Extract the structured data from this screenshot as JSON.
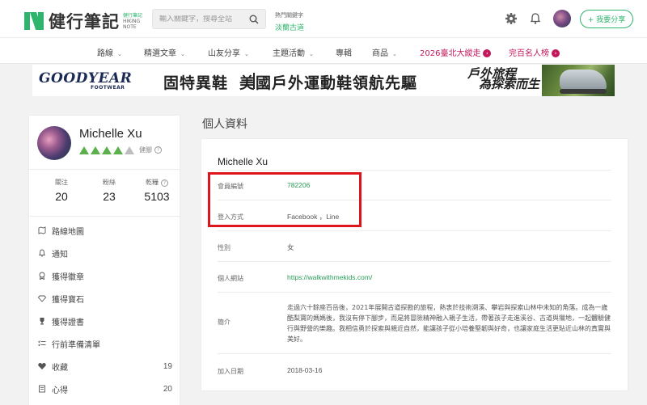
{
  "header": {
    "logo_text": "健行筆記",
    "logo_sub_cn": "健行筆記",
    "logo_sub_en1": "HIKING",
    "logo_sub_en2": "NOTE",
    "search_placeholder": "輸入關鍵字，搜尋全站",
    "hot_label": "熱門關鍵字",
    "hot_keyword": "淡蘭古道",
    "share_label": "+ 我要分享"
  },
  "nav": {
    "items": [
      {
        "label": "路線",
        "caret": "⌄"
      },
      {
        "label": "精選文章",
        "caret": "⌄"
      },
      {
        "label": "山友分享",
        "caret": "⌄"
      },
      {
        "label": "主題活動",
        "caret": "⌄"
      },
      {
        "label": "專輯"
      },
      {
        "label": "商品",
        "caret": "⌄"
      },
      {
        "label": "2026臺北大縱走",
        "badge": "›"
      },
      {
        "label": "完百名人榜",
        "badge": "›"
      }
    ]
  },
  "banner": {
    "brand": "GOODYEAR",
    "brand_sub": "FOOTWEAR",
    "slogan_left": "固特異鞋",
    "slogan_right": "美國戶外運動鞋領航先驅",
    "brush_line1": "戶外旅程",
    "brush_line2": "為探索而生"
  },
  "profile": {
    "name": "Michelle Xu",
    "level_label": "健腳",
    "level_filled": 4,
    "level_total": 5,
    "stats": [
      {
        "label": "關注",
        "value": "20"
      },
      {
        "label": "粉絲",
        "value": "23"
      },
      {
        "label": "乾糧",
        "value": "5103"
      }
    ],
    "menu": [
      {
        "label": "路線地圖",
        "icon": "map-icon",
        "count": ""
      },
      {
        "label": "通知",
        "icon": "bell-icon",
        "count": ""
      },
      {
        "label": "獲得徽章",
        "icon": "badge-icon",
        "count": ""
      },
      {
        "label": "獲得寶石",
        "icon": "gem-icon",
        "count": ""
      },
      {
        "label": "獲得證書",
        "icon": "trophy-icon",
        "count": ""
      },
      {
        "label": "行前準備清單",
        "icon": "checklist-icon",
        "count": ""
      },
      {
        "label": "收藏",
        "icon": "heart-icon",
        "count": "19"
      },
      {
        "label": "心得",
        "icon": "notes-icon",
        "count": "20"
      }
    ]
  },
  "main": {
    "section_title": "個人資料",
    "name": "Michelle Xu",
    "rows": [
      {
        "key": "會員編號",
        "value": "782206"
      },
      {
        "key": "登入方式",
        "value": "Facebook  ，Line"
      },
      {
        "key": "性別",
        "value": "女"
      },
      {
        "key": "個人網站",
        "value": "https://walkwithmekids.com/"
      },
      {
        "key": "簡介",
        "value": "走過六十餘座百岳後，2021年展開古道探勘的旅程，熱衷於技術溯溪、攀岩與探索山林中未知的角落。成為一歲酷梨寶的媽媽後，我沒有停下腳步，而是將冒險精神融入親子生活，帶著孩子走進溪谷、古道與獵地，一起體驗健行與野營的樂趣。我相信勇於探索與親近自然，能讓孩子從小培養堅韌與好奇，也讓家庭生活更貼近山林的真實與美好。"
      },
      {
        "key": "加入日期",
        "value": "2018-03-16"
      }
    ]
  }
}
